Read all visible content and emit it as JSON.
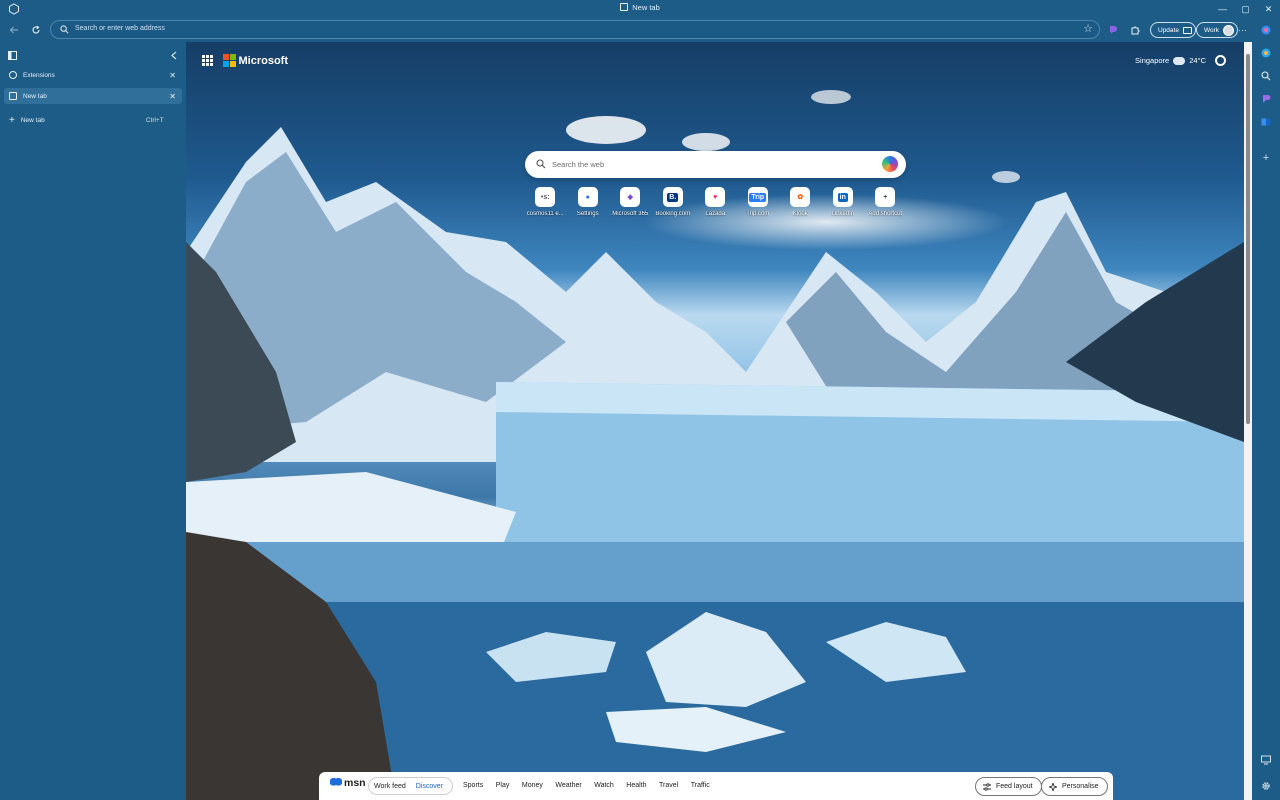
{
  "window": {
    "tab_title": "New tab",
    "controls": [
      "—",
      "▢",
      "✕"
    ]
  },
  "toolbar": {
    "address_placeholder": "Search or enter web address",
    "update_label": "Update",
    "profile_label": "Work",
    "more_label": "···"
  },
  "sidebar": {
    "items": [
      {
        "label": "Extensions",
        "close": "✕"
      },
      {
        "label": "New tab",
        "close": "✕"
      }
    ],
    "new_tab_label": "New tab",
    "new_tab_shortcut": "Ctrl+T"
  },
  "page": {
    "brand": "Microsoft",
    "weather_location": "Singapore",
    "weather_temp": "24°C",
    "search_placeholder": "Search the web",
    "shortcuts": [
      {
        "label": "cosmos11 e...",
        "glyph": "•s:",
        "color": "#5a5a5a"
      },
      {
        "label": "Settings",
        "glyph": "●",
        "color": "#1a73e8"
      },
      {
        "label": "Microsoft 365",
        "glyph": "◆",
        "color": "#7b4bd6"
      },
      {
        "label": "Booking.com",
        "glyph": "B.",
        "color": "#ffffff",
        "bg": "#003580"
      },
      {
        "label": "Lazada",
        "glyph": "♥",
        "color": "#f0284a"
      },
      {
        "label": "Trip.com",
        "glyph": "Trip",
        "color": "#ffffff",
        "bg": "#287dfa"
      },
      {
        "label": "Klook",
        "glyph": "✿",
        "color": "#ff5b00"
      },
      {
        "label": "LinkedIn",
        "glyph": "in",
        "color": "#ffffff",
        "bg": "#0a66c2"
      },
      {
        "label": "Add shortcut",
        "glyph": "+",
        "color": "#444444"
      }
    ]
  },
  "feed": {
    "logo": "msn",
    "toggle": [
      "Work feed",
      "Discover"
    ],
    "links": [
      "Sports",
      "Play",
      "Money",
      "Weather",
      "Watch",
      "Health",
      "Travel",
      "Traffic"
    ],
    "layout_label": "Feed layout",
    "personalise_label": "Personalise"
  },
  "colors": {
    "chrome_bg": "#1d5c86",
    "active_tab": "#2f6f99",
    "accent": "#1a66c9"
  }
}
